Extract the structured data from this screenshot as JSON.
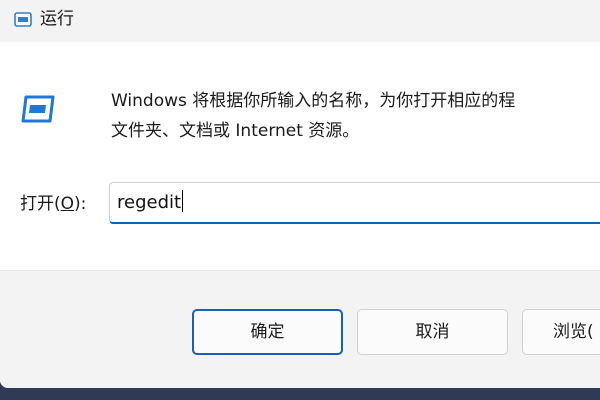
{
  "window": {
    "title": "运行",
    "icon": "run-app-icon"
  },
  "description": {
    "line1": "Windows 将根据你所输入的名称，为你打开相应的程",
    "line2": "文件夹、文档或 Internet 资源。"
  },
  "open": {
    "label_prefix": "打开(",
    "label_accel": "O",
    "label_suffix": "):",
    "value": "regedit"
  },
  "buttons": {
    "ok": "确定",
    "cancel": "取消",
    "browse": "浏览("
  },
  "colors": {
    "accent": "#0067c0",
    "icon_blue": "#2b7fd4"
  }
}
